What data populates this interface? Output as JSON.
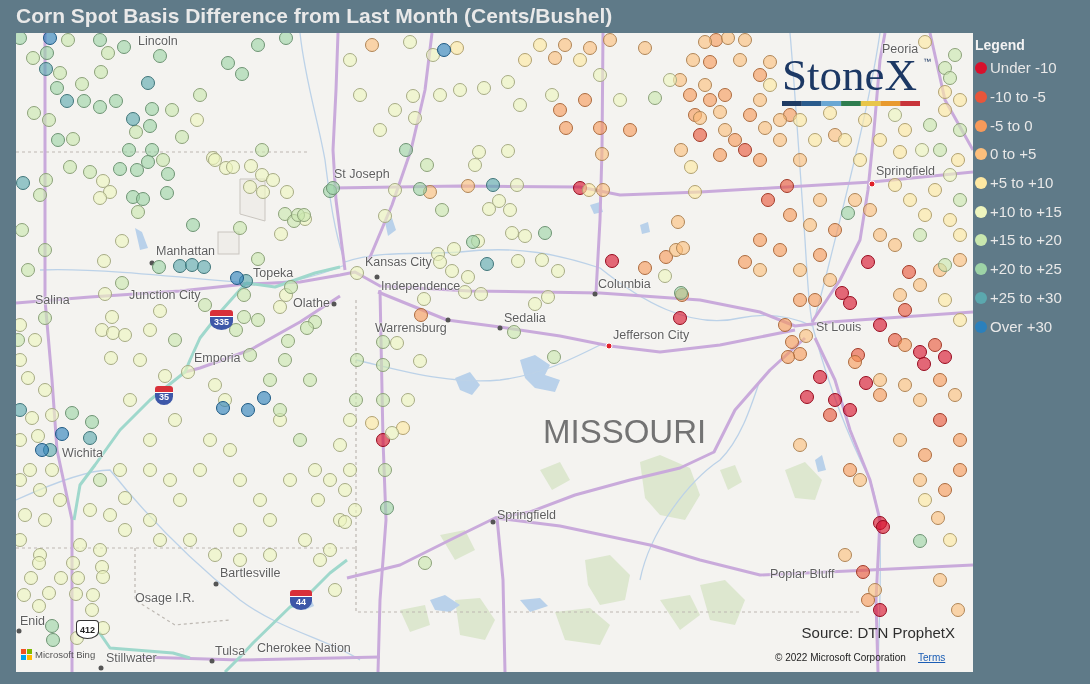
{
  "title": "Corn Spot Basis Difference from Last Month (Cents/Bushel)",
  "map": {
    "places": [
      {
        "name": "Lincoln",
        "kind": "label"
      },
      {
        "name": "Peoria",
        "kind": "label"
      },
      {
        "name": "Springfield",
        "kind": "capital"
      },
      {
        "name": "St Joseph",
        "kind": "label"
      },
      {
        "name": "Manhattan",
        "kind": "city"
      },
      {
        "name": "Kansas City",
        "kind": "city"
      },
      {
        "name": "Topeka",
        "kind": "label"
      },
      {
        "name": "Independence",
        "kind": "label"
      },
      {
        "name": "Columbia",
        "kind": "city"
      },
      {
        "name": "Salina",
        "kind": "label"
      },
      {
        "name": "Junction City",
        "kind": "label"
      },
      {
        "name": "Olathe",
        "kind": "city"
      },
      {
        "name": "Sedalia",
        "kind": "city"
      },
      {
        "name": "Warrensburg",
        "kind": "city"
      },
      {
        "name": "St Louis",
        "kind": "label"
      },
      {
        "name": "Jefferson City",
        "kind": "capital"
      },
      {
        "name": "Emporia",
        "kind": "label"
      },
      {
        "name": "Wichita",
        "kind": "label"
      },
      {
        "name": "Springfield",
        "kind": "city"
      },
      {
        "name": "Bartlesville",
        "kind": "city"
      },
      {
        "name": "Poplar Bluff",
        "kind": "label"
      },
      {
        "name": "Osage I.R.",
        "kind": "label"
      },
      {
        "name": "Enid",
        "kind": "city"
      },
      {
        "name": "Cherokee Nation",
        "kind": "label"
      },
      {
        "name": "Tulsa",
        "kind": "city"
      },
      {
        "name": "Stillwater",
        "kind": "city"
      }
    ],
    "state_label": "MISSOURI",
    "route_shields": [
      {
        "number": "335",
        "kind": "interstate"
      },
      {
        "number": "35",
        "kind": "interstate"
      },
      {
        "number": "412",
        "kind": "us_route"
      },
      {
        "number": "44",
        "kind": "interstate"
      }
    ],
    "logo": {
      "wordmark": "StoneX",
      "trademark": "™"
    },
    "source": "Source: DTN ProphetX",
    "attribution": {
      "provider": "Microsoft Bing",
      "copyright": "© 2022 Microsoft Corporation",
      "terms_link": "Terms"
    }
  },
  "legend": {
    "title": "Legend",
    "items": [
      {
        "label": "Under -10",
        "color": "#d8102c"
      },
      {
        "label": "-10 to -5",
        "color": "#e8553a"
      },
      {
        "label": "-5 to 0",
        "color": "#f79a5a"
      },
      {
        "label": "0 to +5",
        "color": "#fcbf7c"
      },
      {
        "label": "+5 to +10",
        "color": "#fee8a2"
      },
      {
        "label": "+10 to +15",
        "color": "#eef5be"
      },
      {
        "label": "+15 to +20",
        "color": "#c9e7ae"
      },
      {
        "label": "+20 to +25",
        "color": "#9dd3a6"
      },
      {
        "label": "+25 to +30",
        "color": "#5ba8ae"
      },
      {
        "label": "Over +30",
        "color": "#2b80bc"
      }
    ]
  }
}
